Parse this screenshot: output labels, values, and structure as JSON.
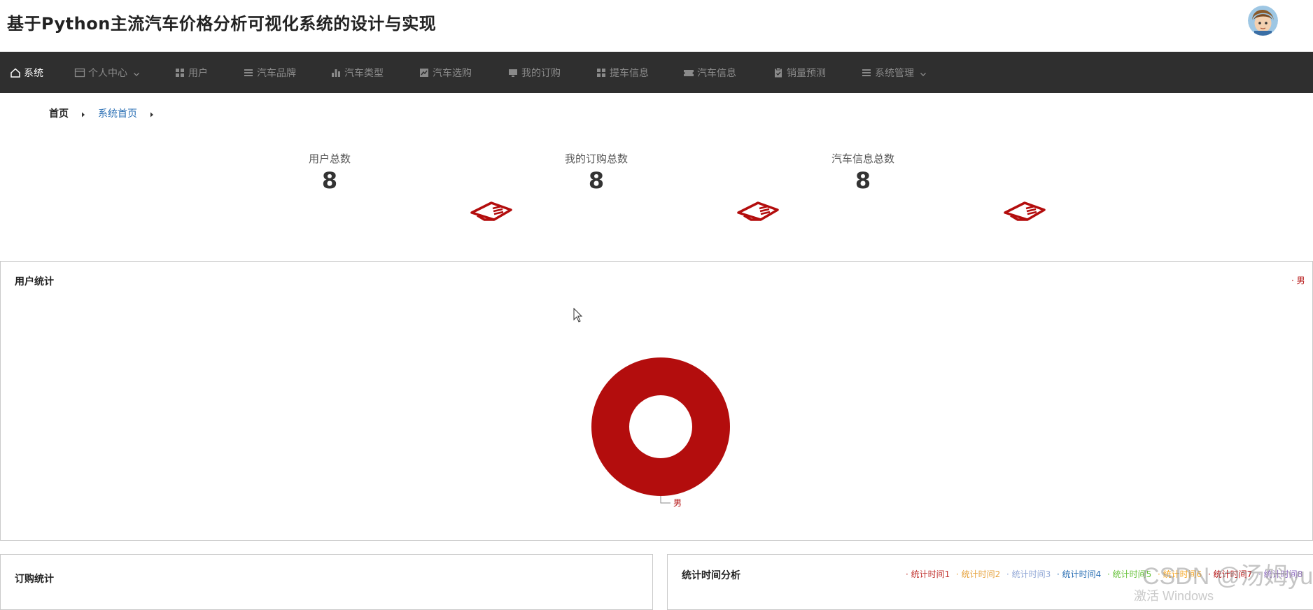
{
  "app": {
    "title": "基于Python主流汽车价格分析可视化系统的设计与实现"
  },
  "nav": {
    "items": [
      {
        "label": "系统",
        "icon": "home-icon",
        "active": true
      },
      {
        "label": "个人中心",
        "icon": "calendar-icon",
        "has_dropdown": true
      },
      {
        "label": "用户",
        "icon": "grid-icon"
      },
      {
        "label": "汽车品牌",
        "icon": "list-icon"
      },
      {
        "label": "汽车类型",
        "icon": "bar-chart-icon"
      },
      {
        "label": "汽车选购",
        "icon": "chart-box-icon"
      },
      {
        "label": "我的订购",
        "icon": "monitor-icon"
      },
      {
        "label": "提车信息",
        "icon": "grid-icon"
      },
      {
        "label": "汽车信息",
        "icon": "ticket-icon"
      },
      {
        "label": "销量预测",
        "icon": "clipboard-icon"
      },
      {
        "label": "系统管理",
        "icon": "list-icon",
        "has_dropdown": true
      }
    ]
  },
  "breadcrumb": {
    "home": "首页",
    "current": "系统首页"
  },
  "stats": [
    {
      "label": "用户总数",
      "value": "8"
    },
    {
      "label": "我的订购总数",
      "value": "8"
    },
    {
      "label": "汽车信息总数",
      "value": "8"
    }
  ],
  "user_panel": {
    "title": "用户统计",
    "legend": "男"
  },
  "order_panel": {
    "title": "订购统计"
  },
  "time_panel": {
    "title": "统计时间分析",
    "legend": [
      "统计时间1",
      "统计时间2",
      "统计时间3",
      "统计时间4",
      "统计时间5",
      "统计时间6",
      "统计时间7",
      "统计时间8"
    ]
  },
  "chart_data": {
    "type": "pie",
    "title": "用户统计",
    "categories": [
      "男"
    ],
    "values": [
      8
    ],
    "colors": [
      "#b30d0d"
    ],
    "legend_position": "top-right"
  },
  "watermark": {
    "text": "CSDN @汤姆yu",
    "activation": "激活 Windows"
  },
  "colors": {
    "accent": "#b30d0d",
    "navbar": "#2f2f2f",
    "link": "#2a6fb4",
    "legend": [
      "#c23531",
      "#e6a23c",
      "#91a7d6",
      "#2a6fb4",
      "#67c23a",
      "#f5a623",
      "#b30d0d",
      "#8e6bbf"
    ]
  }
}
